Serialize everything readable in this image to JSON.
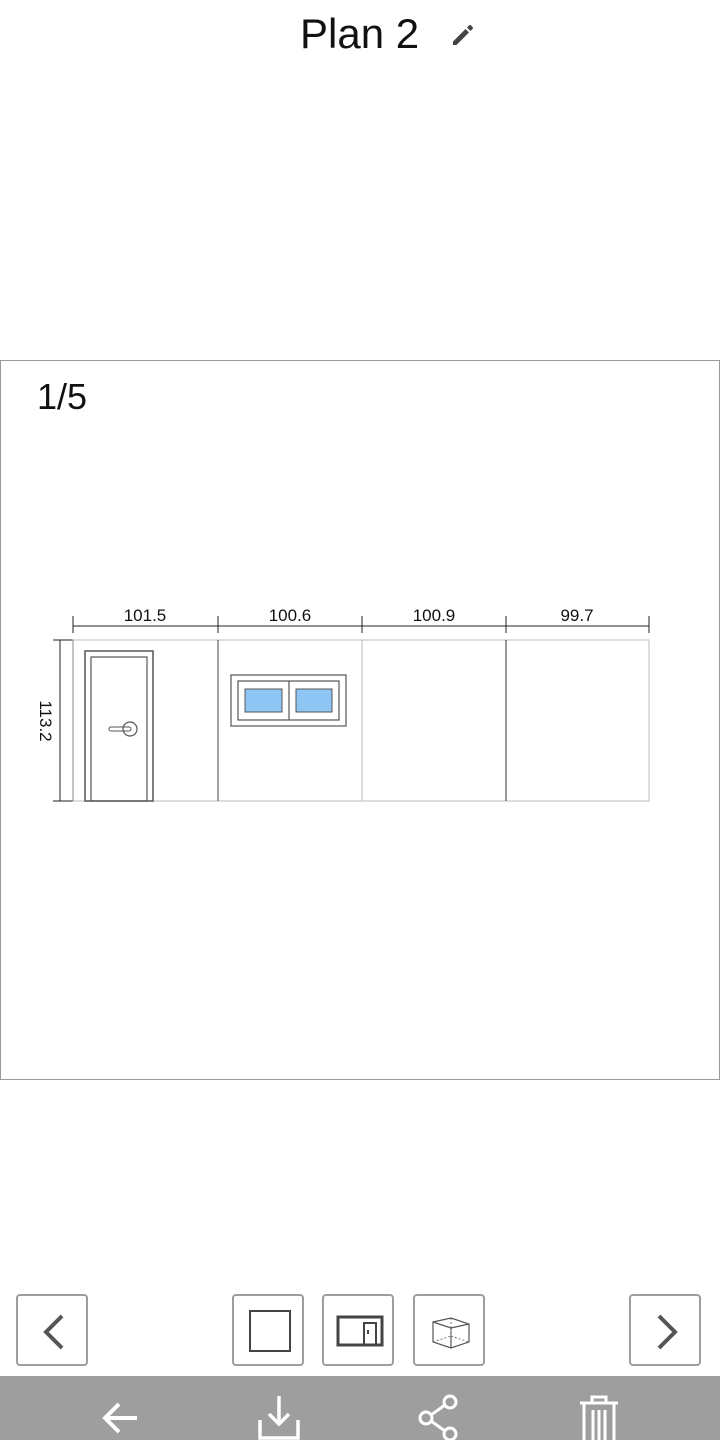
{
  "header": {
    "title": "Plan 2",
    "edit_icon": "pencil-icon"
  },
  "viewer": {
    "page_indicator": "1/5",
    "wall_height_label": "113.2",
    "segments": [
      {
        "width_label": "101.5",
        "feature": "door"
      },
      {
        "width_label": "100.6",
        "feature": "window"
      },
      {
        "width_label": "100.9",
        "feature": "none"
      },
      {
        "width_label": "99.7",
        "feature": "none"
      }
    ],
    "window_glass_color": "#8ec5f4"
  },
  "toolbar": {
    "prev_icon": "chevron-left-icon",
    "wall_icon": "square-wall-icon",
    "door_window_icon": "door-window-icon",
    "cube_icon": "3d-cube-icon",
    "next_icon": "chevron-right-icon"
  },
  "bottom_bar": {
    "color": "#9e9e9e",
    "icons": [
      "back-arrow-icon",
      "download-icon",
      "share-icon",
      "trash-icon"
    ]
  }
}
